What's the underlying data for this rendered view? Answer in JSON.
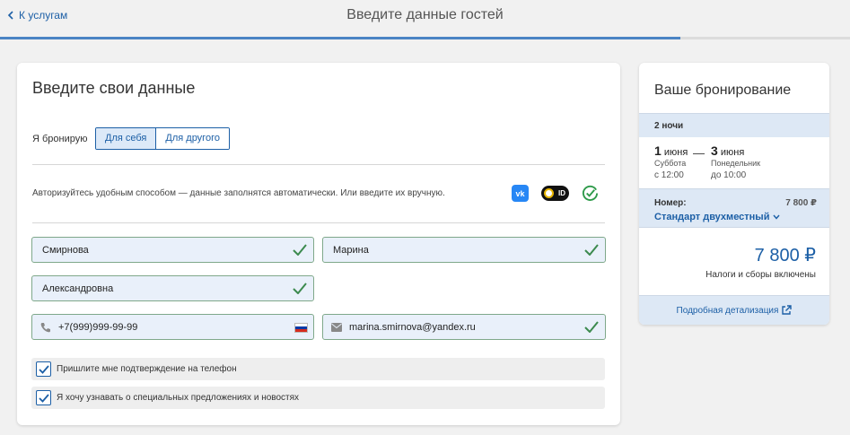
{
  "header": {
    "back_label": "К услугам",
    "title": "Введите данные гостей",
    "progress_fraction": 0.8
  },
  "form": {
    "title": "Введите свои данные",
    "booking_for_label": "Я бронирую",
    "options": [
      {
        "label": "Для себя",
        "selected": true
      },
      {
        "label": "Для другого",
        "selected": false
      }
    ],
    "auth_text": "Авторизуйтесь удобным способом — данные заполнятся автоматически. Или введите их вручную.",
    "auth_icons": {
      "vk": "vk-icon",
      "sber": "sber-id-icon",
      "sber_text": "ID",
      "vk_text": "vk",
      "gos": "gosuslugi-check-icon"
    },
    "fields": {
      "surname": "Смирнова",
      "name": "Марина",
      "patronymic": "Александровна",
      "phone": "+7(999)999-99-99",
      "email": "marina.smirnova@yandex.ru"
    },
    "checkboxes": [
      {
        "label": "Пришлите мне подтверждение на телефон",
        "checked": true
      },
      {
        "label": "Я хочу узнавать о специальных предложениях и новостях",
        "checked": true
      }
    ]
  },
  "booking": {
    "title": "Ваше бронирование",
    "nights": "2 ночи",
    "checkin": {
      "day": "1",
      "month": "июня",
      "weekday": "Суббота",
      "time": "с 12:00"
    },
    "checkout": {
      "day": "3",
      "month": "июня",
      "weekday": "Понедельник",
      "time": "до 10:00"
    },
    "dash": "—",
    "room_label": "Номер:",
    "room_price": "7 800 ₽",
    "room_name": "Стандарт двухместный",
    "total": "7 800 ₽",
    "taxes": "Налоги и сборы включены",
    "details_link": "Подробная детализация"
  },
  "colors": {
    "accent": "#1c5fa6",
    "progress": "#4b84c4",
    "success": "#3c8a4e",
    "panel": "#dde8f5"
  }
}
